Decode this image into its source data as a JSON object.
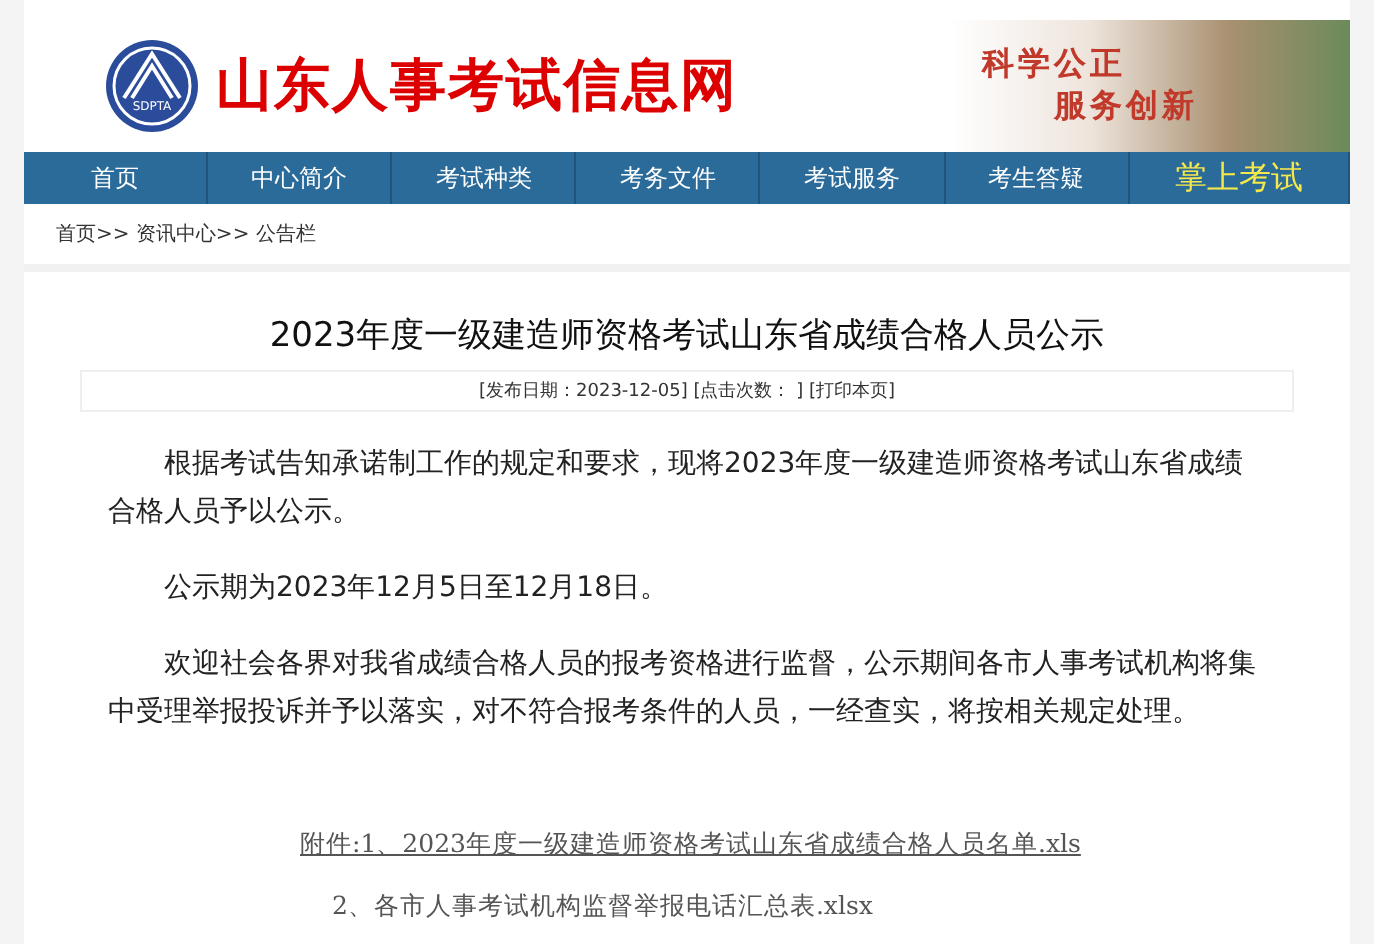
{
  "header": {
    "logo_text": "SDPTA",
    "site_title": "山东人事考试信息网",
    "slogan": [
      "科学公正",
      "服务创新"
    ]
  },
  "nav": [
    {
      "label": "首页",
      "kind": "normal"
    },
    {
      "label": "中心简介",
      "kind": "normal"
    },
    {
      "label": "考试种类",
      "kind": "normal"
    },
    {
      "label": "考务文件",
      "kind": "normal"
    },
    {
      "label": "考试服务",
      "kind": "normal"
    },
    {
      "label": "考生答疑",
      "kind": "normal"
    },
    {
      "label": "掌上考试",
      "kind": "highlight"
    }
  ],
  "breadcrumb": "首页>> 资讯中心>> 公告栏",
  "article": {
    "title": "2023年度一级建造师资格考试山东省成绩合格人员公示",
    "meta": "[发布日期：2023-12-05] [点击次数：  ] [打印本页]",
    "paragraphs": [
      "根据考试告知承诺制工作的规定和要求，现将2023年度一级建造师资格考试山东省成绩合格人员予以公示。",
      "公示期为2023年12月5日至12月18日。",
      "欢迎社会各界对我省成绩合格人员的报考资格进行监督，公示期间各市人事考试机构将集中受理举报投诉并予以落实，对不符合报考条件的人员，一经查实，将按相关规定处理。"
    ],
    "attachments": [
      "附件:1、2023年度一级建造师资格考试山东省成绩合格人员名单.xls",
      "2、各市人事考试机构监督举报电话汇总表.xlsx"
    ]
  }
}
